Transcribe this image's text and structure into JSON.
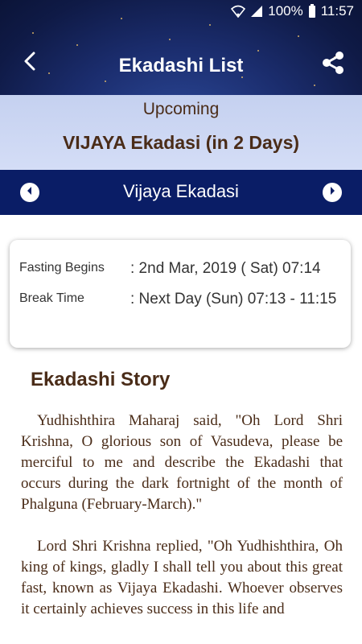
{
  "status_bar": {
    "battery": "100%",
    "time": "11:57"
  },
  "header": {
    "title": "Ekadashi List",
    "back_icon": "chevron-left-icon",
    "share_icon": "share-icon"
  },
  "upcoming": {
    "label": "Upcoming",
    "name": "VIJAYA Ekadasi (in 2 Days)"
  },
  "nav": {
    "title": "Vijaya Ekadasi",
    "prev_icon": "chevron-left-circle-icon",
    "next_icon": "chevron-right-circle-icon"
  },
  "timings": {
    "fasting_label": "Fasting Begins",
    "fasting_value": ": 2nd Mar, 2019 ( Sat) 07:14",
    "break_label": "Break Time",
    "break_value": ": Next Day (Sun) 07:13 - 11:15"
  },
  "story": {
    "title": "Ekadashi Story",
    "paragraphs": [
      "Yudhishthira Maharaj said, \"Oh Lord Shri Krishna, O glorious son of Vasudeva, please be merciful to me and describe the Ekadashi that occurs during the dark fortnight of the month of Phalguna (February-March).\"",
      "Lord Shri Krishna replied, \"Oh Yudhishthira, Oh king of kings, gladly I shall tell you about this great fast, known as Vijaya Ekadashi. Whoever observes it certainly achieves success in this life and"
    ]
  },
  "colors": {
    "header_dark": "#0f1a46",
    "nav_bar": "#0a1d66",
    "upcoming_band": "#c9d4f2",
    "text_brown": "#4a2c18"
  }
}
